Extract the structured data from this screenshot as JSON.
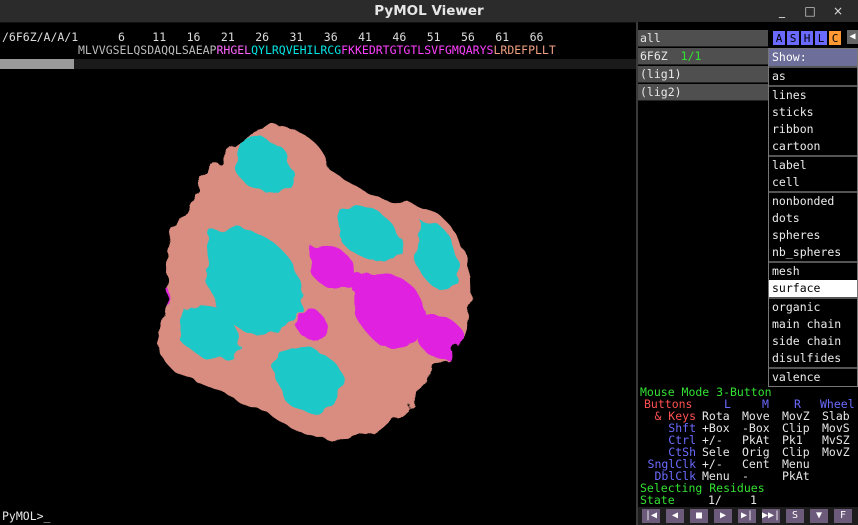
{
  "window": {
    "title": "PyMOL Viewer",
    "controls": [
      "_",
      "□",
      "×"
    ]
  },
  "sequence": {
    "object_label": "/6F6Z/A/A/1",
    "numbers": [
      "6",
      "11",
      "16",
      "21",
      "26",
      "31",
      "36",
      "41",
      "46",
      "51",
      "56",
      "61",
      "66"
    ],
    "segments": [
      {
        "text": "MLVVGSELQSDAQQLSAEAP",
        "color": "#bcbcbc"
      },
      {
        "text": "RHGEL",
        "color": "#ff66ff"
      },
      {
        "text": "QYLRQVEHILRCG",
        "color": "#00e5e5"
      },
      {
        "text": "FKKEDRTGTGTL",
        "color": "#ff40ff"
      },
      {
        "text": "SVFGMQARYS",
        "color": "#ff40ff"
      },
      {
        "text": "LRDEFPLLT",
        "color": "#f0a080"
      }
    ]
  },
  "command": {
    "prompt": "PyMOL>_"
  },
  "objects": [
    {
      "name": "all",
      "state": ""
    },
    {
      "name": "6F6Z",
      "state": "1/1"
    },
    {
      "name": "(lig1)",
      "state": ""
    },
    {
      "name": "(lig2)",
      "state": ""
    }
  ],
  "object_buttons": [
    {
      "label": "A",
      "color": "#6a6aff"
    },
    {
      "label": "S",
      "color": "#6a6aff"
    },
    {
      "label": "H",
      "color": "#6a6aff"
    },
    {
      "label": "L",
      "color": "#6a6aff"
    },
    {
      "label": "C",
      "color": "#ff9933"
    }
  ],
  "show_menu": {
    "title": "Show:",
    "groups": [
      [
        "as"
      ],
      [
        "lines",
        "sticks",
        "ribbon",
        "cartoon"
      ],
      [
        "label",
        "cell"
      ],
      [
        "nonbonded",
        "dots",
        "spheres",
        "nb_spheres"
      ],
      [
        "mesh",
        "surface"
      ],
      [
        "organic",
        "main chain",
        "side chain",
        "disulfides"
      ],
      [
        "valence"
      ]
    ],
    "selected": "surface"
  },
  "mouse_panel": {
    "mode": "Mouse Mode 3-Button",
    "buttons_label": "Buttons",
    "cols": [
      "L",
      "M",
      "R",
      "Wheel"
    ],
    "rows": [
      {
        "mod": "& Keys",
        "vals": [
          "Rota",
          "Move",
          "MovZ",
          "Slab"
        ]
      },
      {
        "mod": "Shft",
        "vals": [
          "+Box",
          "-Box",
          "Clip",
          "MovS"
        ]
      },
      {
        "mod": "Ctrl",
        "vals": [
          "+/-",
          "PkAt",
          "Pk1",
          "MvSZ"
        ]
      },
      {
        "mod": "CtSh",
        "vals": [
          "Sele",
          "Orig",
          "Clip",
          "MovZ"
        ]
      },
      {
        "mod": "SnglClk",
        "vals": [
          "+/-",
          "Cent",
          "Menu",
          ""
        ]
      },
      {
        "mod": "DblClk",
        "vals": [
          "Menu",
          "-",
          "PkAt",
          ""
        ]
      }
    ],
    "selecting": "Selecting Residues",
    "state_label": "State",
    "state_value": "1/",
    "state_total": "1"
  },
  "playback": [
    "|◀",
    "◀",
    "■",
    "▶",
    "▶|",
    "▶▶|",
    "S",
    "▼",
    "F"
  ],
  "colors": {
    "salmon": "#d98d80",
    "cyan": "#1cc8c8",
    "magenta": "#e020e0"
  }
}
